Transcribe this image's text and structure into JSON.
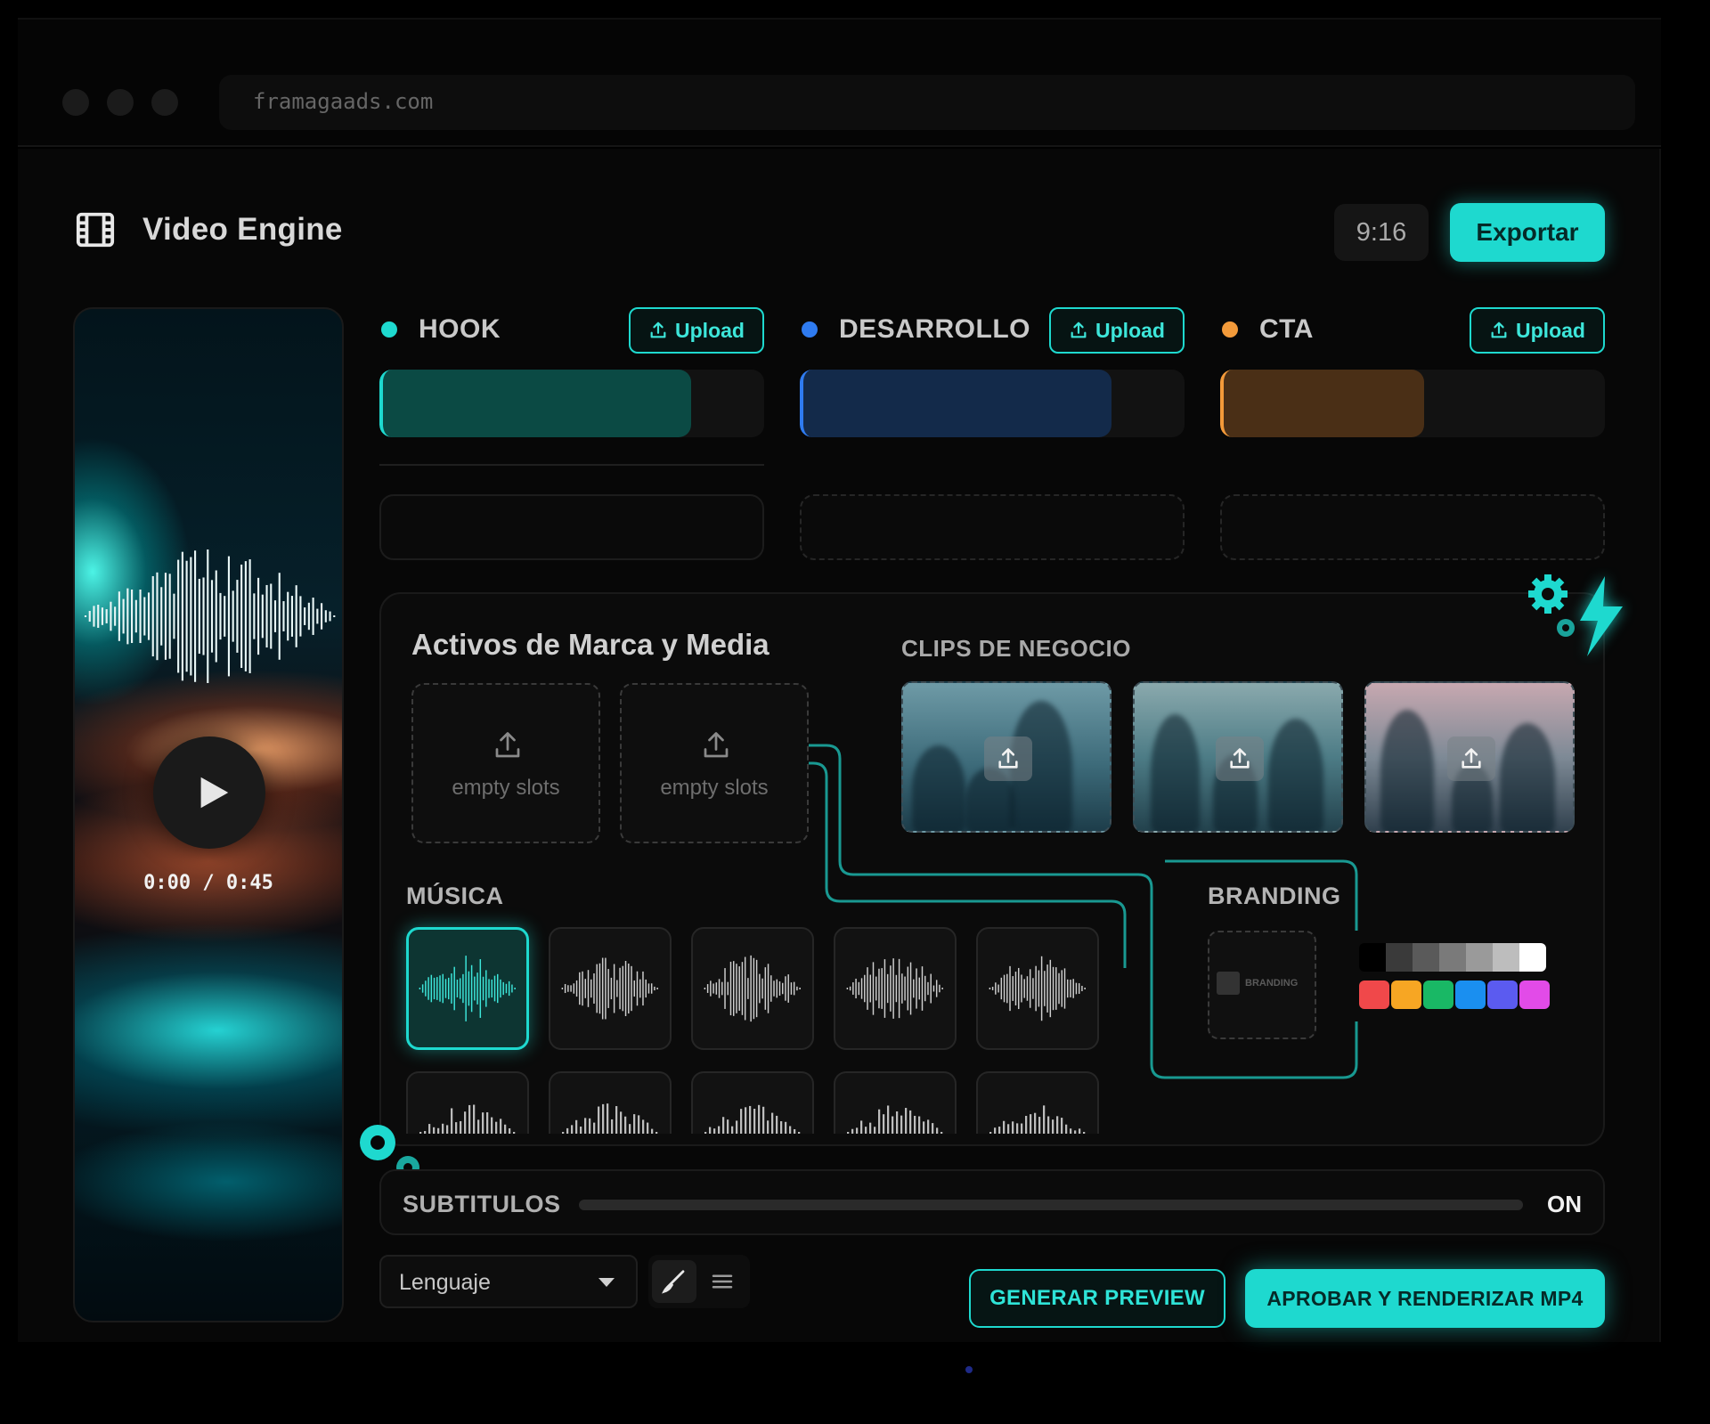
{
  "browser": {
    "url": "framagaads.com"
  },
  "header": {
    "title": "Video Engine",
    "aspect_ratio": "9:16",
    "export_label": "Exportar"
  },
  "player": {
    "timecode": "0:00 / 0:45"
  },
  "segments": [
    {
      "label": "HOOK",
      "dot_color": "#1ed9cf",
      "upload_label": "Upload",
      "fill_color": "#0b4a44",
      "fill_fraction": 0.81
    },
    {
      "label": "DESARROLLO",
      "dot_color": "#2f7bf0",
      "upload_label": "Upload",
      "fill_color": "#132a4a",
      "fill_fraction": 0.81
    },
    {
      "label": "CTA",
      "dot_color": "#f39a3a",
      "upload_label": "Upload",
      "fill_color": "#4a2f16",
      "fill_fraction": 0.53
    }
  ],
  "assets": {
    "title": "Activos de Marca y Media",
    "empty_slots": [
      "empty slots",
      "empty slots"
    ],
    "clips_title": "CLIPS DE NEGOCIO",
    "clips_count": 3,
    "music_label": "MÚSICA",
    "branding_label": "BRANDING",
    "branding_logo_text": "BRANDING",
    "palette_grays": [
      "#000000",
      "#3a3a3a",
      "#5a5a5a",
      "#7a7a7a",
      "#9a9a9a",
      "#bdbdbd",
      "#ffffff"
    ],
    "palette_colors": [
      "#f0484a",
      "#f7a623",
      "#19b865",
      "#1a8ff0",
      "#5b5bf0",
      "#e24be8"
    ]
  },
  "subtitles": {
    "label": "SUBTITULOS",
    "state": "ON"
  },
  "controls": {
    "language_label": "Lenguaje",
    "generate_preview_label": "GENERAR PREVIEW",
    "render_label": "APROBAR Y RENDERIZAR MP4"
  },
  "colors": {
    "accent": "#1ed9cf",
    "background": "#070707"
  }
}
